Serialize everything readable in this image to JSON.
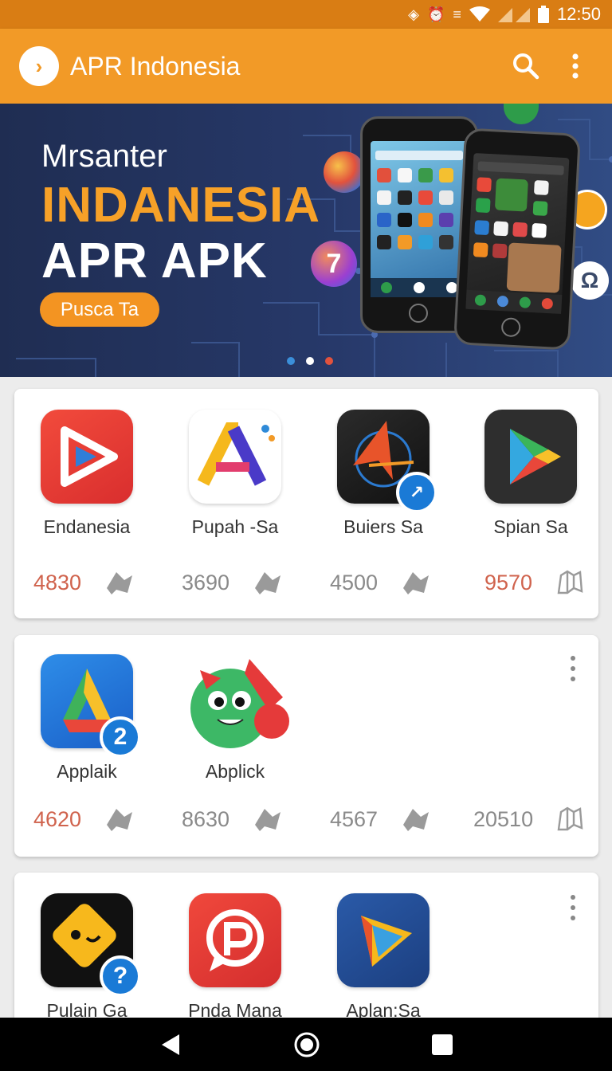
{
  "status_bar": {
    "time": "12:50",
    "icons": [
      "nfc-icon",
      "alarm-icon",
      "vibrate-icon",
      "wifi-icon",
      "signal-icon",
      "battery-icon"
    ]
  },
  "app_bar": {
    "title": "APR Indonesia"
  },
  "banner": {
    "line1": "Mrsanter",
    "line2": "INDANESIA",
    "line3": "APR  APK",
    "button": "Pusca Ta"
  },
  "cards": [
    {
      "apps": [
        {
          "name": "Endanesia",
          "icon": "video-play-icon"
        },
        {
          "name": "Pupah -Sa",
          "icon": "letter-a-icon"
        },
        {
          "name": "Buiers Sa",
          "icon": "navigation-arrow-icon"
        },
        {
          "name": "Spian Sa",
          "icon": "play-store-icon"
        }
      ],
      "stats": [
        "4830",
        "3690",
        "4500",
        "9570"
      ]
    },
    {
      "apps": [
        {
          "name": "Applaik",
          "icon": "drive-icon",
          "badge": "2"
        },
        {
          "name": "Abplick",
          "icon": "green-monster-icon"
        }
      ],
      "stats": [
        "4620",
        "8630",
        "4567",
        "20510"
      ]
    },
    {
      "apps": [
        {
          "name": "Pulain Ga",
          "icon": "yellow-face-icon",
          "badge": "?"
        },
        {
          "name": "Pnda Mana",
          "icon": "chat-p-icon"
        },
        {
          "name": "Aplan:Sa",
          "icon": "blue-play-icon"
        }
      ]
    }
  ],
  "colors": {
    "primary": "#f29a27",
    "status_bar": "#d97d14",
    "accent_red": "#d0634d",
    "stat_gray": "#8a8a8a"
  }
}
